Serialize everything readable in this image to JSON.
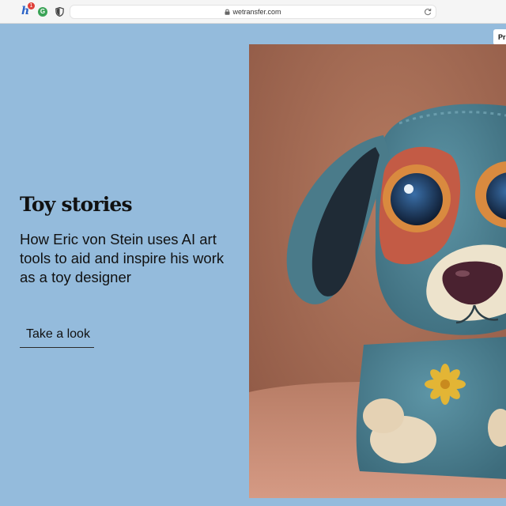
{
  "browser": {
    "url": "wetransfer.com",
    "extensions": [
      {
        "name": "honey-extension",
        "letter": "h",
        "badge": "1"
      },
      {
        "name": "grammarly-extension",
        "letter": "G"
      },
      {
        "name": "privacy-shield-extension"
      }
    ]
  },
  "privacy_tab": {
    "label": "Pri"
  },
  "promo": {
    "title": "Toy stories",
    "description": "How Eric von Stein uses AI art tools to aid and inspire his work as a toy designer",
    "cta_label": "Take a look"
  },
  "hero_image": {
    "subject": "felted blue toy puppy with big eyes"
  },
  "colors": {
    "page_background": "#94bbdc",
    "text": "#111111",
    "toy_blue": "#4f8396",
    "eye_ring_orange": "#d98a3f",
    "hero_background": "#a46a52"
  }
}
